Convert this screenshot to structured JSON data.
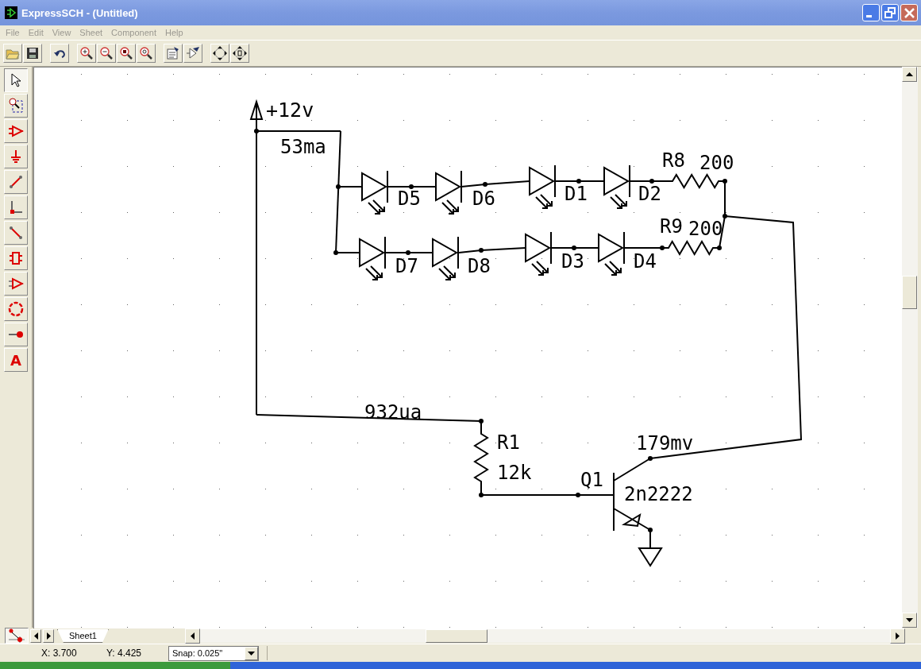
{
  "window": {
    "title": "ExpressSCH - (Untitled)"
  },
  "menu": [
    {
      "label": "File",
      "disabled": true
    },
    {
      "label": "Edit",
      "disabled": true
    },
    {
      "label": "View",
      "disabled": true
    },
    {
      "label": "Sheet",
      "disabled": true
    },
    {
      "label": "Component",
      "disabled": true
    },
    {
      "label": "Help",
      "disabled": true
    }
  ],
  "tools": [
    {
      "kind": "pointer",
      "selected": true
    },
    {
      "kind": "zoom-area",
      "selected": false
    },
    {
      "kind": "component",
      "selected": false
    },
    {
      "kind": "ground",
      "selected": false
    },
    {
      "kind": "wire",
      "selected": false
    },
    {
      "kind": "corner",
      "selected": false
    },
    {
      "kind": "line",
      "selected": false
    },
    {
      "kind": "ic",
      "selected": false
    },
    {
      "kind": "gate",
      "selected": false
    },
    {
      "kind": "circle",
      "selected": false
    },
    {
      "kind": "pin",
      "selected": false
    },
    {
      "kind": "text",
      "selected": false,
      "glyph": "A"
    }
  ],
  "schematic": {
    "power": "+12v",
    "annotations": [
      "53ma",
      "932ua",
      "179mv"
    ],
    "leds": [
      "D5",
      "D6",
      "D1",
      "D2",
      "D7",
      "D8",
      "D3",
      "D4"
    ],
    "resistors": [
      {
        "ref": "R8",
        "value": "200"
      },
      {
        "ref": "R9",
        "value": "200"
      },
      {
        "ref": "R1",
        "value": "12k"
      }
    ],
    "transistor": {
      "ref": "Q1",
      "value": "2n2222"
    }
  },
  "tabs": [
    {
      "label": "Sheet1",
      "selected": true
    }
  ],
  "status": {
    "x": "X: 3.700",
    "y": "Y: 4.425",
    "snap": "Snap:  0.025\""
  }
}
